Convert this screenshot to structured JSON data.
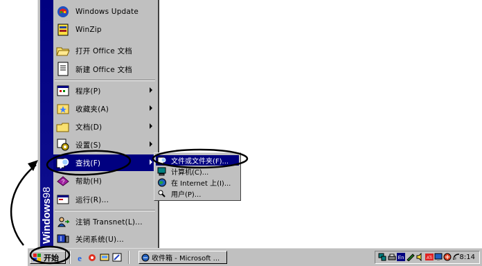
{
  "start_menu": {
    "brand_bold": "Windows",
    "brand_version": "98",
    "items": [
      {
        "label": "Windows Update",
        "icon": "windows-update-icon"
      },
      {
        "label": "WinZip",
        "icon": "winzip-icon"
      },
      {
        "label": "打开 Office 文档",
        "icon": "open-folder-icon"
      },
      {
        "label": "新建 Office 文档",
        "icon": "new-document-icon"
      },
      {
        "label": "程序(P)",
        "icon": "programs-icon"
      },
      {
        "label": "收藏夹(A)",
        "icon": "favorites-icon"
      },
      {
        "label": "文档(D)",
        "icon": "documents-icon"
      },
      {
        "label": "设置(S)",
        "icon": "settings-icon"
      },
      {
        "label": "查找(F)",
        "icon": "find-icon"
      },
      {
        "label": "帮助(H)",
        "icon": "help-icon"
      },
      {
        "label": "运行(R)...",
        "icon": "run-icon"
      },
      {
        "label": "注销 Transnet(L)...",
        "icon": "logoff-icon"
      },
      {
        "label": "关闭系统(U)...",
        "icon": "shutdown-icon"
      }
    ]
  },
  "find_submenu": {
    "items": [
      {
        "label": "文件或文件夹(F)...",
        "icon": "file-search-icon"
      },
      {
        "label": "计算机(C)...",
        "icon": "computer-icon"
      },
      {
        "label": "在 Internet 上(I)...",
        "icon": "internet-icon"
      },
      {
        "label": "用户(P)...",
        "icon": "people-icon"
      }
    ]
  },
  "taskbar": {
    "start_label": "开始",
    "task_button_label": "收件箱 - Microsoft ...",
    "clock": "8:14"
  },
  "colors": {
    "menu_bg": "#c0c0c0",
    "highlight": "#000080",
    "banner": "#000080"
  }
}
